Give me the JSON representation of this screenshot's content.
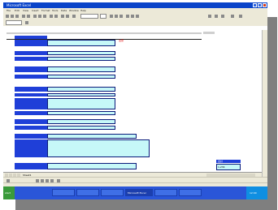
{
  "window": {
    "title": "Microsoft Excel"
  },
  "menu": {
    "items": [
      "File",
      "Edit",
      "View",
      "Insert",
      "Format",
      "Tools",
      "Data",
      "Window",
      "Help"
    ]
  },
  "sheet": {
    "flag": "注意",
    "sheet_tab": "Sheet1",
    "summary_label": "合計",
    "summary_value": "1,234"
  },
  "taskbar": {
    "start_label": "start",
    "items": [
      "",
      "",
      "",
      "Microsoft Excel",
      "",
      ""
    ],
    "clock": "12:00"
  },
  "colors": {
    "label_blue": "#1f3fd8",
    "cell_cyan": "#c6f8f8",
    "titlebar_blue": "#0a44c9",
    "taskbar_blue": "#2a56d8",
    "start_green": "#3a9a3a",
    "flag_red": "#e00000"
  }
}
